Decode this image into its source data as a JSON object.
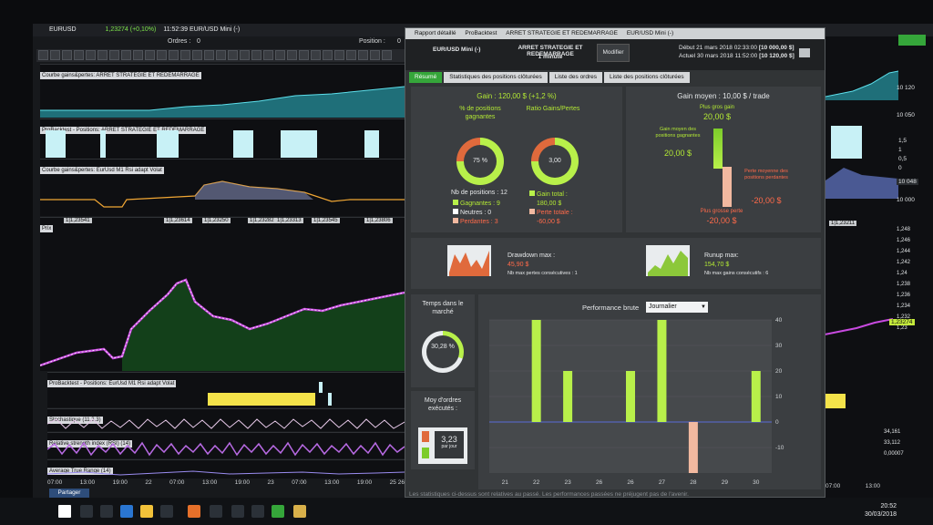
{
  "bg": {
    "title_symbol": "EURUSD",
    "price_info": "1,23274 (+0,10%)",
    "time_info": "11:52:39 EUR/USD Mini (-)",
    "orders_label": "Ordres :",
    "orders_value": "0",
    "position_label": "Position :",
    "position_value": "0",
    "panel1_title": "Courbe gains&pertes: ARRET STRATEGIE ET REDEMARRAGE",
    "panel2_title": "ProBacktest - Positions: ARRET STRATEGIE ET REDEMARRAGE",
    "panel3_title": "Courbe gains&pertes: EurUsd M1 Rsi adapt Volat",
    "price_panel_title": "Prix",
    "price_labels": [
      "1|1,23541",
      "1|1,23614",
      "1|1,23250",
      "1|1,23282",
      "1|1,23313",
      "1|1,23545",
      "1|1,23806"
    ],
    "panel5_title": "ProBacktest - Positions: EurUsd M1 Rsi adapt Volat",
    "stoch_title": "Stochastique (11,3,3)",
    "rsi_title": "Relative strength index (RSI) (14)",
    "atr_title": "Average True Range (14)",
    "time_axis": [
      "07:00",
      "13:00",
      "19:00",
      "22",
      "07:00",
      "13:00",
      "19:00",
      "23",
      "07:00",
      "13:00",
      "19:00",
      "25 26"
    ],
    "right_axis_top": [
      "10 120",
      "10 050"
    ],
    "right_axis_mid": [
      "1,5",
      "1",
      "0,5",
      "0"
    ],
    "right_axis_eq": "10 048",
    "right_axis_eq2": "10 000",
    "right_price_axis": [
      "1,248",
      "1,246",
      "1,244",
      "1,242",
      "1,24",
      "1,238",
      "1,236",
      "1,234",
      "1,232",
      "1,23",
      "1,228",
      "1,226",
      "1,224",
      "1,222"
    ],
    "right_price_badge": "1,23274",
    "right_price_small": "1|1,23211",
    "right_stoch_vals": [
      "34,161",
      "33,112",
      "0,00007"
    ],
    "right_time_axis": [
      "07:00",
      "13:00"
    ]
  },
  "report": {
    "window_title": "Rapport détaillé",
    "window_tabs": [
      "ProBacktest",
      "ARRET STRATEGIE ET REDEMARRAGE",
      "EUR/USD Mini (-)"
    ],
    "instrument": "EUR/USD Mini (-)",
    "strategy": "ARRET STRATEGIE ET REDEMARRAGE",
    "timeframe": "1 minute",
    "modify_button": "Modifier",
    "debut_label": "Début",
    "debut_value": "21 mars 2018 02:33:00",
    "debut_capital": "[10 000,00 $]",
    "actuel_label": "Actuel",
    "actuel_value": "30 mars 2018 11:52:00",
    "actuel_capital": "[10 120,00 $]",
    "tabs": [
      "Résumé",
      "Statistiques des positions clôturées",
      "Liste des ordres",
      "Liste des positions clôturées"
    ],
    "gain": "Gain : 120,00 $ (+1,2 %)",
    "pct_winning_label": "% de positions gagnantes",
    "pct_winning_value": "75 %",
    "ratio_label": "Ratio Gains/Pertes",
    "ratio_value": "3,00",
    "nb_positions": "Nb de positions : 12",
    "gagnantes": "Gagnantes : 9",
    "neutres": "Neutres : 0",
    "perdantes": "Perdantes : 3",
    "gain_total_label": "Gain total :",
    "gain_total_value": "180,00 $",
    "perte_totale_label": "Perte totale :",
    "perte_totale_value": "-60,00 $",
    "gain_moyen": "Gain moyen : 10,00 $ / trade",
    "plus_gros_gain_label": "Plus gros gain",
    "plus_gros_gain_value": "20,00 $",
    "gain_moyen_pos_label": "Gain moyen des positions gagnantes",
    "gain_moyen_pos_value": "20,00 $",
    "perte_moyenne_label": "Perte moyenne des positions perdantes",
    "perte_moyenne_value": "-20,00 $",
    "plus_grosse_perte_label": "Plus grosse perte",
    "plus_grosse_perte_value": "-20,00 $",
    "drawdown_label": "Drawdown max :",
    "drawdown_value": "45,90 $",
    "drawdown_sub": "Nb max pertes consécutives : 1",
    "runup_label": "Runup max:",
    "runup_value": "154,70 $",
    "runup_sub": "Nb max gains consécutifs : 6",
    "temps_label": "Temps dans le marché",
    "temps_value": "30,28 %",
    "moy_label": "Moy d'ordres exécutés :",
    "moy_value": "3,23",
    "moy_unit": "par jour",
    "perf_label": "Performance brute",
    "perf_select": "Journalier",
    "footer": "Les statistiques ci-dessus sont relatives au passé. Les performances passées ne préjugent pas de l'avenir."
  },
  "chart_data": {
    "type": "bar",
    "title": "Performance brute",
    "categories": [
      "21",
      "22",
      "23",
      "26",
      "26",
      "27",
      "28",
      "29",
      "30"
    ],
    "values": [
      0,
      40,
      20,
      0,
      20,
      40,
      -20,
      0,
      20
    ],
    "ylim": [
      -20,
      40
    ],
    "yticks": [
      -10,
      0,
      10,
      20,
      30,
      40
    ],
    "colors": {
      "positive": "#b8f04a",
      "negative": "#f2b9a0"
    }
  },
  "taskbar": {
    "start_label": "Partager",
    "clock_time": "20:52",
    "clock_date": "30/03/2018"
  }
}
